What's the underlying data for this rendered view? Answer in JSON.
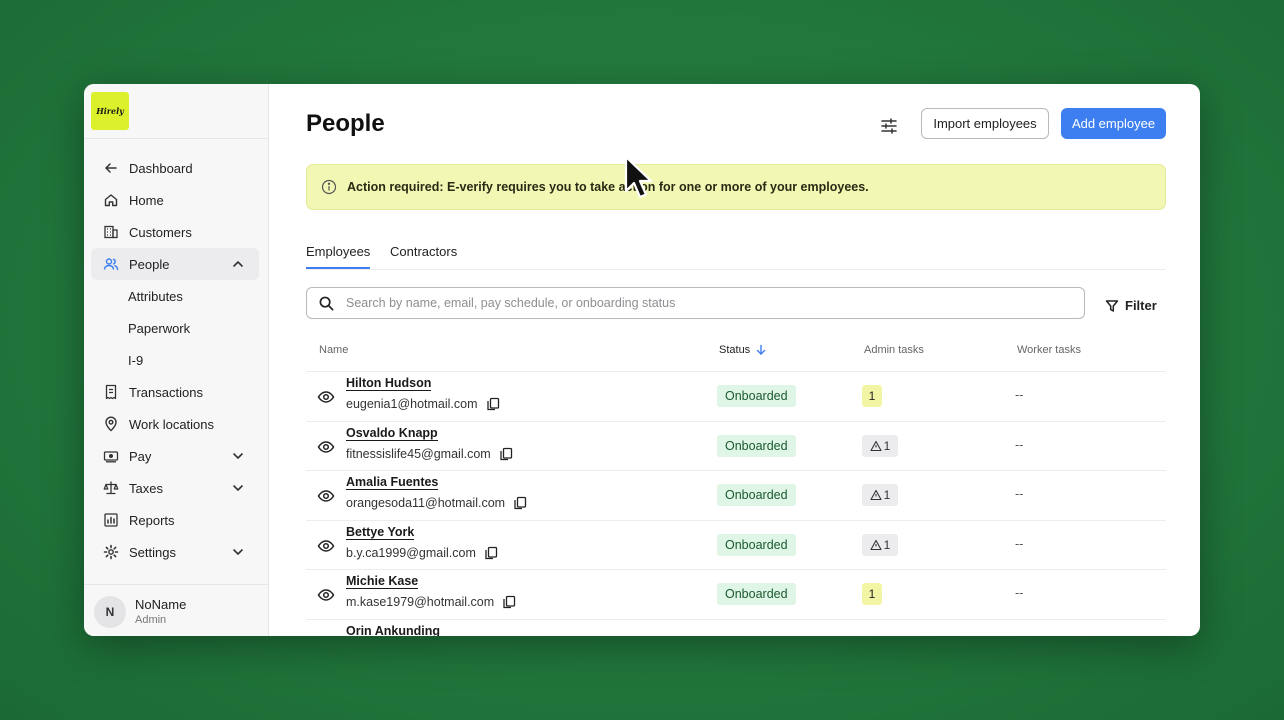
{
  "app": {
    "logo_text": "Hirely"
  },
  "sidebar": {
    "items": [
      {
        "label": "Dashboard",
        "icon": "arrow-left-icon"
      },
      {
        "label": "Home",
        "icon": "home-icon"
      },
      {
        "label": "Customers",
        "icon": "building-icon"
      },
      {
        "label": "People",
        "icon": "people-icon",
        "active": true,
        "expanded": true
      },
      {
        "label": "Attributes",
        "sub": true
      },
      {
        "label": "Paperwork",
        "sub": true
      },
      {
        "label": "I-9",
        "sub": true
      },
      {
        "label": "Transactions",
        "icon": "receipt-icon"
      },
      {
        "label": "Work locations",
        "icon": "location-pin-icon"
      },
      {
        "label": "Pay",
        "icon": "money-icon",
        "collapsible": true
      },
      {
        "label": "Taxes",
        "icon": "scale-icon",
        "collapsible": true
      },
      {
        "label": "Reports",
        "icon": "chart-icon"
      },
      {
        "label": "Settings",
        "icon": "gear-icon",
        "collapsible": true
      }
    ],
    "user": {
      "initial": "N",
      "name": "NoName",
      "role": "Admin"
    }
  },
  "header": {
    "title": "People",
    "import_label": "Import employees",
    "add_label": "Add employee"
  },
  "alert": {
    "text": "Action required: E-verify requires you to take action for one or more of your employees."
  },
  "tabs": [
    {
      "label": "Employees",
      "active": true
    },
    {
      "label": "Contractors"
    }
  ],
  "search": {
    "placeholder": "Search by name, email, pay schedule, or onboarding status"
  },
  "filter_label": "Filter",
  "table": {
    "columns": {
      "name": "Name",
      "status": "Status",
      "admin": "Admin tasks",
      "worker": "Worker tasks"
    },
    "rows": [
      {
        "name": "Hilton Hudson",
        "email": "eugenia1@hotmail.com",
        "status": "Onboarded",
        "admin_tasks": "1",
        "admin_warning": false,
        "worker_tasks": "--"
      },
      {
        "name": "Osvaldo Knapp",
        "email": "fitnessislife45@gmail.com",
        "status": "Onboarded",
        "admin_tasks": "1",
        "admin_warning": true,
        "worker_tasks": "--"
      },
      {
        "name": "Amalia Fuentes",
        "email": "orangesoda11@hotmail.com",
        "status": "Onboarded",
        "admin_tasks": "1",
        "admin_warning": true,
        "worker_tasks": "--"
      },
      {
        "name": "Bettye York",
        "email": "b.y.ca1999@gmail.com",
        "status": "Onboarded",
        "admin_tasks": "1",
        "admin_warning": true,
        "worker_tasks": "--"
      },
      {
        "name": "Michie Kase",
        "email": "m.kase1979@hotmail.com",
        "status": "Onboarded",
        "admin_tasks": "1",
        "admin_warning": false,
        "worker_tasks": "--"
      },
      {
        "name": "Orin Ankunding",
        "email": "",
        "status": "",
        "admin_tasks": "",
        "admin_warning": false,
        "worker_tasks": ""
      }
    ]
  },
  "colors": {
    "accent": "#3d7ff0",
    "logo_bg": "#dcf12b",
    "alert_bg": "#f3f7b4",
    "badge_bg": "#dff5e5"
  }
}
